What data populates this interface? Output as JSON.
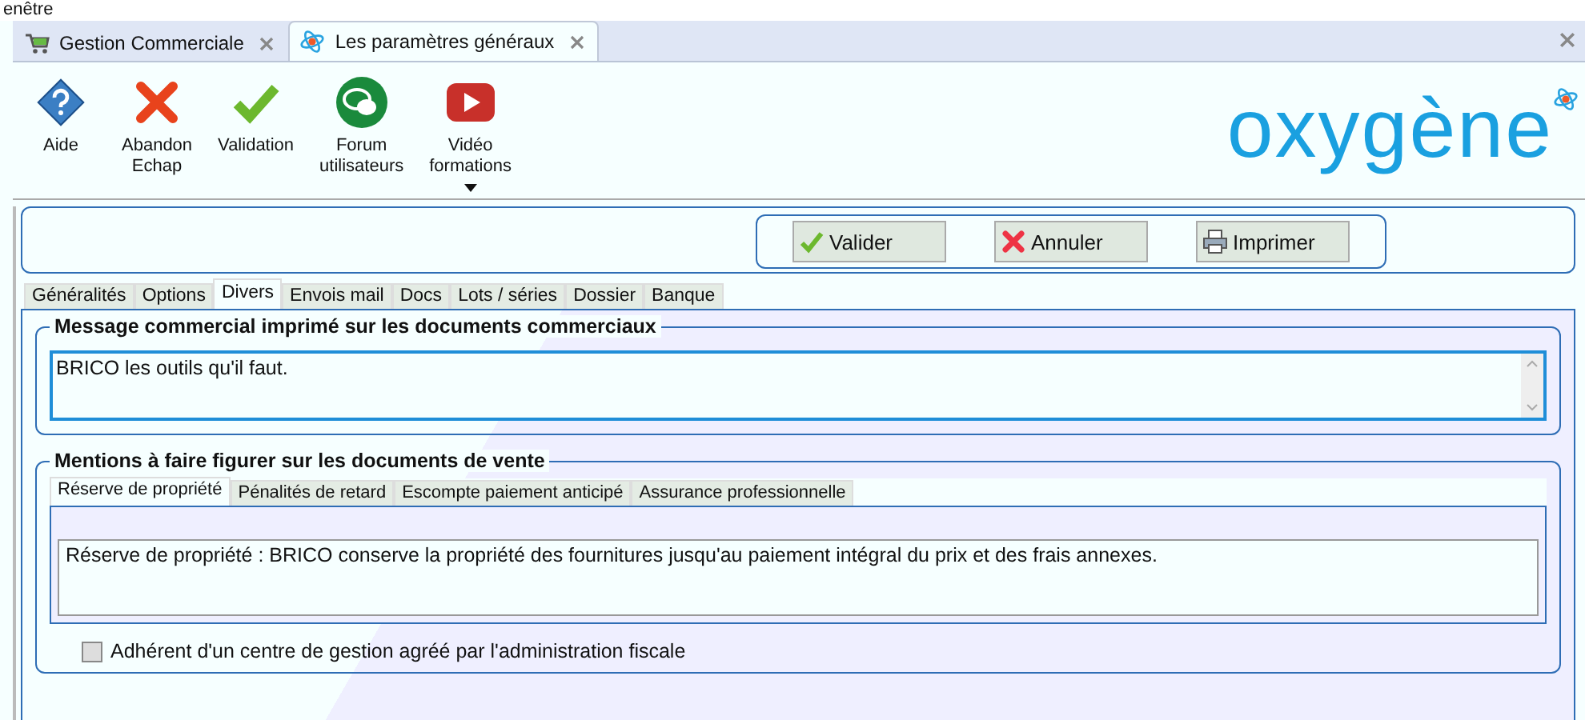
{
  "menu_fragment": "enêtre",
  "doc_tabs": [
    {
      "label": "Gestion Commerciale",
      "kind": "cart",
      "selected": false
    },
    {
      "label": "Les paramètres généraux",
      "kind": "atom",
      "selected": true
    }
  ],
  "toolbar": [
    {
      "label": "Aide",
      "kind": "help"
    },
    {
      "label": "Abandon\nEchap",
      "kind": "cancel"
    },
    {
      "label": "Validation",
      "kind": "check"
    },
    {
      "label": "Forum\nutilisateurs",
      "kind": "forum"
    },
    {
      "label": "Vidéo\nformations",
      "kind": "video",
      "dropdown": true
    }
  ],
  "logo": "oxygène",
  "actions": [
    {
      "label": "Valider",
      "kind": "check"
    },
    {
      "label": "Annuler",
      "kind": "cancel"
    },
    {
      "label": "Imprimer",
      "kind": "print"
    }
  ],
  "tabs": [
    {
      "label": "Généralités",
      "selected": false
    },
    {
      "label": "Options",
      "selected": false
    },
    {
      "label": "Divers",
      "selected": true
    },
    {
      "label": "Envois mail",
      "selected": false
    },
    {
      "label": "Docs",
      "selected": false
    },
    {
      "label": "Lots / séries",
      "selected": false
    },
    {
      "label": "Dossier",
      "selected": false
    },
    {
      "label": "Banque",
      "selected": false
    }
  ],
  "message_group": {
    "title": "Message commercial imprimé sur les documents commerciaux",
    "value": "BRICO les outils qu'il faut."
  },
  "mentions_group": {
    "title": "Mentions à faire figurer sur les documents de vente",
    "tabs": [
      {
        "label": "Réserve de propriété",
        "selected": true
      },
      {
        "label": "Pénalités de retard",
        "selected": false
      },
      {
        "label": "Escompte paiement anticipé",
        "selected": false
      },
      {
        "label": "Assurance professionnelle",
        "selected": false
      }
    ],
    "value": "Réserve de propriété : BRICO conserve la propriété des fournitures jusqu'au paiement intégral du prix et des frais annexes.",
    "checkbox": {
      "label": "Adhérent d'un centre de gestion agréé par l'administration fiscale",
      "checked": false
    }
  }
}
